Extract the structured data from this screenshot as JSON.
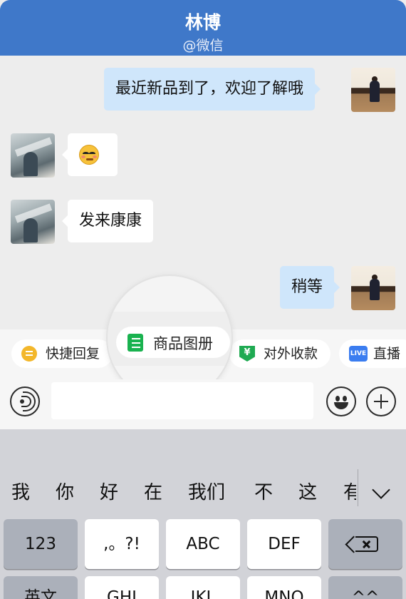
{
  "header": {
    "title": "林博",
    "subtitle": "@微信"
  },
  "messages": [
    {
      "side": "self",
      "text": "最近新品到了，欢迎了解哦"
    },
    {
      "side": "other",
      "emoji": "smirk-face-emoji"
    },
    {
      "side": "other",
      "text": "发来康康"
    },
    {
      "side": "self",
      "text": "稍等"
    }
  ],
  "shortcuts": [
    {
      "label": "快捷回复",
      "icon": "quick-reply-icon",
      "color": "#f3b72b"
    },
    {
      "label": "商品图册",
      "icon": "product-album-icon",
      "color": "#19b24f"
    },
    {
      "label": "对外收款",
      "icon": "payment-shield-icon",
      "color": "#1faa52",
      "glyph": "¥"
    },
    {
      "label": "直播",
      "icon": "live-icon",
      "color": "#3b7df0",
      "glyph": "LIVE"
    }
  ],
  "input": {
    "placeholder": "",
    "value": ""
  },
  "keyboard": {
    "candidates": [
      "我",
      "你",
      "好",
      "在",
      "我们",
      "不",
      "这",
      "有"
    ],
    "row1": [
      "123",
      ",。?!",
      "ABC",
      "DEF"
    ],
    "row2": [
      "英文",
      "GHI",
      "JKL",
      "MNO",
      "^^"
    ]
  }
}
